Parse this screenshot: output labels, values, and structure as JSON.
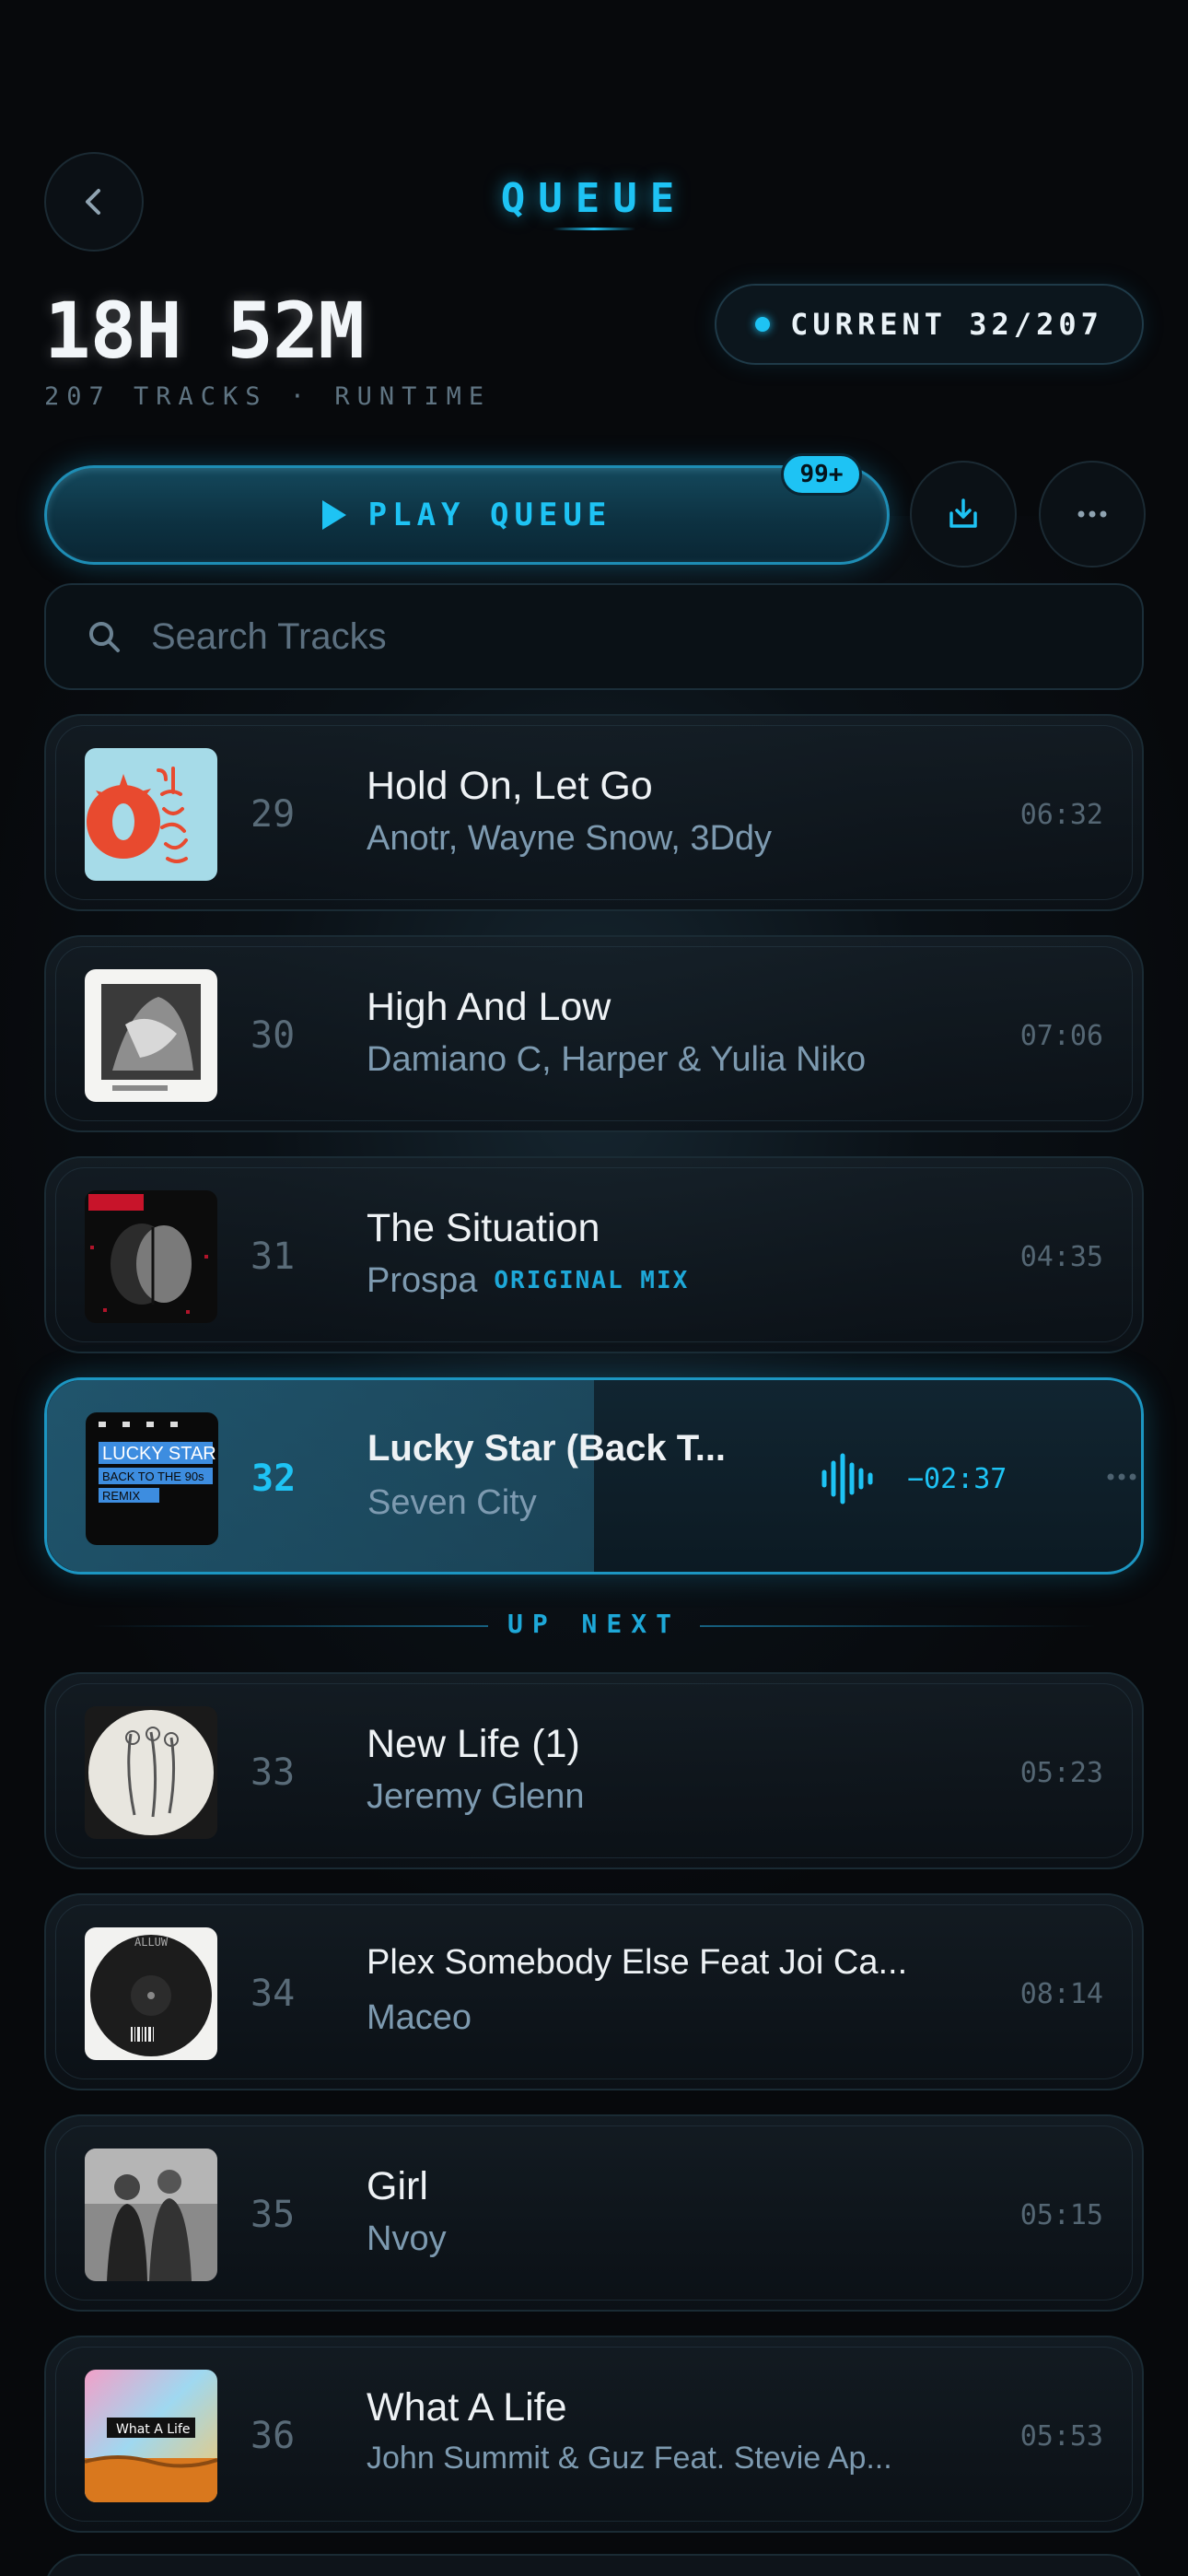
{
  "header": {
    "title": "QUEUE",
    "runtime": "18H 52M",
    "runtime_sub": "207 TRACKS · RUNTIME",
    "current_label": "CURRENT 32/207"
  },
  "controls": {
    "play_label": "PLAY QUEUE",
    "badge": "99+",
    "download_icon": "download-icon",
    "more_icon": "more-icon"
  },
  "search": {
    "placeholder": "Search Tracks",
    "value": ""
  },
  "up_next_label": "UP NEXT",
  "current_track": {
    "index": "32",
    "title": "Lucky Star (Back T...",
    "artist": "Seven City",
    "remaining": "−02:37",
    "progress": 0.5
  },
  "tracks": [
    {
      "index": "29",
      "title": "Hold On, Let Go",
      "artist": "Anotr, Wayne Snow, 3Ddy",
      "duration": "06:32"
    },
    {
      "index": "30",
      "title": "High And Low",
      "artist": "Damiano C, Harper & Yulia Niko",
      "duration": "07:06"
    },
    {
      "index": "31",
      "title": "The Situation",
      "artist": "Prospa",
      "tag": "ORIGINAL MIX",
      "duration": "04:35"
    },
    {
      "index": "33",
      "title": "New Life (1)",
      "artist": "Jeremy Glenn",
      "duration": "05:23"
    },
    {
      "index": "34",
      "title": "Plex Somebody Else Feat Joi Ca...",
      "artist": "Maceo",
      "duration": "08:14"
    },
    {
      "index": "35",
      "title": "Girl",
      "artist": "Nvoy",
      "duration": "05:15"
    },
    {
      "index": "36",
      "title": "What A Life",
      "artist": "John Summit & Guz Feat. Stevie Ap...",
      "duration": "05:53"
    }
  ],
  "colors": {
    "accent": "#1ec3f4",
    "background": "#07090c"
  }
}
